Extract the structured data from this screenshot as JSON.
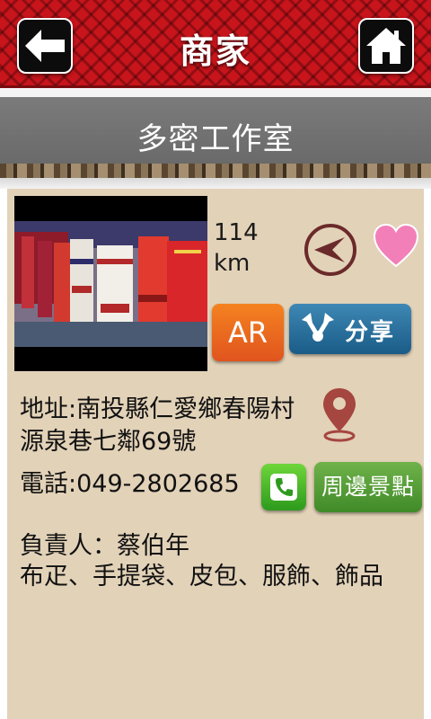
{
  "header": {
    "title": "商家",
    "back_icon": "back-arrow-icon",
    "home_icon": "home-icon",
    "accent_color": "#c8141b"
  },
  "shop": {
    "name": "多密工作室"
  },
  "detail": {
    "photo_alt": "traditional-clothing-photo",
    "distance_value": "114",
    "distance_unit": "km",
    "ar_label": "AR",
    "share_label": "分享",
    "address": "地址:南投縣仁愛鄉春陽村源泉巷七鄰69號",
    "phone": "電話:049-2802685",
    "nearby_label": "周邊景點",
    "owner": "負責人：蔡伯年",
    "products": "布疋、手提袋、皮包、服飾、飾品",
    "icons": {
      "navigate": "navigation-arrow-icon",
      "favorite": "heart-icon",
      "share": "share-icon",
      "location": "map-pin-icon",
      "call": "phone-icon"
    },
    "colors": {
      "card_bg": "#e2d2b8",
      "ar_orange": "#f58220",
      "share_blue": "#1a5c88",
      "nearby_green": "#4f9a33",
      "heart_pink": "#f27fb8"
    }
  }
}
